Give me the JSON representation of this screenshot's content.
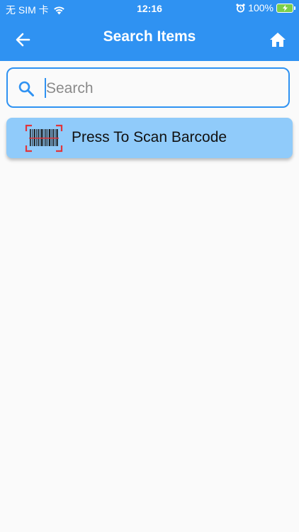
{
  "status_bar": {
    "carrier": "无 SIM 卡",
    "time": "12:16",
    "battery": "100%"
  },
  "app_bar": {
    "title": "Search Items"
  },
  "search": {
    "placeholder": "Search",
    "value": ""
  },
  "scan_button": {
    "label": "Press To Scan Barcode"
  },
  "colors": {
    "primary": "#2f92f2",
    "scan_button_bg": "#90cbfa",
    "background": "#fafafa"
  }
}
